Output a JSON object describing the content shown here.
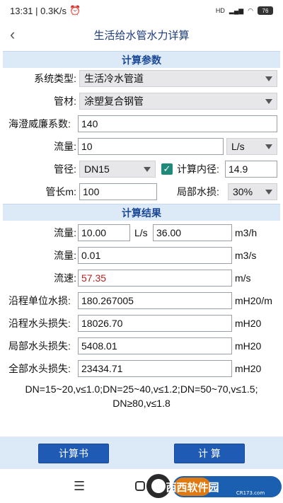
{
  "status": {
    "time_speed": "13:31 | 0.3K/s",
    "alarm_icon": "alarm-icon",
    "signal": "HD",
    "battery": "76"
  },
  "titlebar": {
    "title": "生活给水管水力详算",
    "back_icon": "back-chevron-icon"
  },
  "params": {
    "header": "计算参数",
    "system_type": {
      "label": "系统类型:",
      "value": "生活冷水管道"
    },
    "material": {
      "label": "管材:",
      "value": "涂塑复合钢管"
    },
    "hazen": {
      "label": "海澄威廉系数:",
      "value": "140"
    },
    "flow": {
      "label": "流量:",
      "value": "10",
      "unit": "L/s"
    },
    "diameter": {
      "label": "管径:",
      "value": "DN15",
      "check_label": "计算内径:",
      "inner": "14.9",
      "checked": true
    },
    "length": {
      "label": "管长m:",
      "value": "100",
      "local_label": "局部水损:",
      "local_value": "30%"
    }
  },
  "results": {
    "header": "计算结果",
    "flow1": {
      "label": "流量:",
      "value1": "10.00",
      "unit1": "L/s",
      "value2": "36.00",
      "unit2": "m3/h"
    },
    "flow2": {
      "label": "流量:",
      "value": "0.01",
      "unit": "m3/s"
    },
    "velocity": {
      "label": "流速:",
      "value": "57.35",
      "unit": "m/s"
    },
    "unit_loss": {
      "label": "沿程单位水损:",
      "value": "180.267005",
      "unit": "mH20/m"
    },
    "head_loss": {
      "label": "沿程水头损失:",
      "value": "18026.70",
      "unit": "mH20"
    },
    "local_loss": {
      "label": "局部水头损失:",
      "value": "5408.01",
      "unit": "mH20"
    },
    "total_loss": {
      "label": "全部水头损失:",
      "value": "23434.71",
      "unit": "mH20"
    }
  },
  "note": {
    "line1": "DN=15~20,v≤1.0;DN=25~40,v≤1.2;DN=50~70,v≤1.5;",
    "line2": "DN≥80,v≤1.8"
  },
  "buttons": {
    "book": "计算书",
    "calc": "计  算"
  },
  "watermark": {
    "text": "西西软件园",
    "sub": "CR173.com"
  }
}
